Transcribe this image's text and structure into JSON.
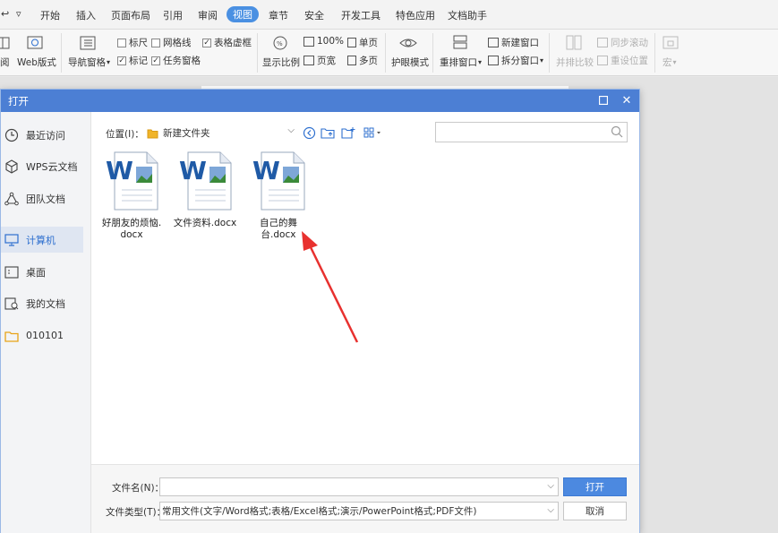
{
  "menubar": {
    "items": [
      {
        "label": "开始"
      },
      {
        "label": "插入"
      },
      {
        "label": "页面布局"
      },
      {
        "label": "引用"
      },
      {
        "label": "审阅"
      },
      {
        "label": "视图"
      },
      {
        "label": "章节"
      },
      {
        "label": "安全"
      },
      {
        "label": "开发工具"
      },
      {
        "label": "特色应用"
      },
      {
        "label": "文档助手"
      }
    ],
    "active": "视图"
  },
  "ribbon": {
    "read_mode_label": "阅",
    "web_layout_label": "Web版式",
    "nav_pane_label": "导航窗格",
    "ruler_label": "标尺",
    "gridlines_label": "网格线",
    "table_gridlines_label": "表格虚框",
    "markup_label": "标记",
    "task_pane_label": "任务窗格",
    "zoom_label": "显示比例",
    "zoom_100_label": "100%",
    "page_width_label": "页宽",
    "single_page_label": "单页",
    "multi_page_label": "多页",
    "eye_mode_label": "护眼模式",
    "arrange_label": "重排窗口",
    "new_window_label": "新建窗口",
    "split_window_label": "拆分窗口",
    "side_by_side_label": "并排比较",
    "sync_scroll_label": "同步滚动",
    "reset_position_label": "重设位置",
    "macro_label": "宏"
  },
  "dialog": {
    "title": "打开",
    "sidebar": [
      {
        "label": "最近访问",
        "icon": "clock-icon"
      },
      {
        "label": "WPS云文档",
        "icon": "cube-icon"
      },
      {
        "label": "团队文档",
        "icon": "team-icon"
      },
      {
        "label": "计算机",
        "icon": "monitor-icon"
      },
      {
        "label": "桌面",
        "icon": "desktop-icon"
      },
      {
        "label": "我的文档",
        "icon": "my-documents-icon"
      },
      {
        "label": "010101",
        "icon": "folder-icon"
      }
    ],
    "selected_sidebar": "计算机",
    "location_label": "位置(I)：",
    "location_value": "新建文件夹",
    "search_placeholder": "",
    "files": [
      {
        "name_line1": "好朋友的烦恼.",
        "name_line2": "docx"
      },
      {
        "name_line1": "文件资料.docx",
        "name_line2": ""
      },
      {
        "name_line1": "自己的舞台.docx",
        "name_line2": ""
      }
    ],
    "filename_label": "文件名(N)：",
    "filename_value": "",
    "filetype_label": "文件类型(T)：",
    "filetype_value": "常用文件(文字/Word格式;表格/Excel格式;演示/PowerPoint格式;PDF文件)",
    "open_button": "打开",
    "cancel_button": "取消"
  },
  "colors": {
    "accent": "#4c7fd4",
    "primary_button": "#4c89e0",
    "selected_sidebar": "#dfe6f2",
    "annotation_arrow": "#e8312f"
  }
}
